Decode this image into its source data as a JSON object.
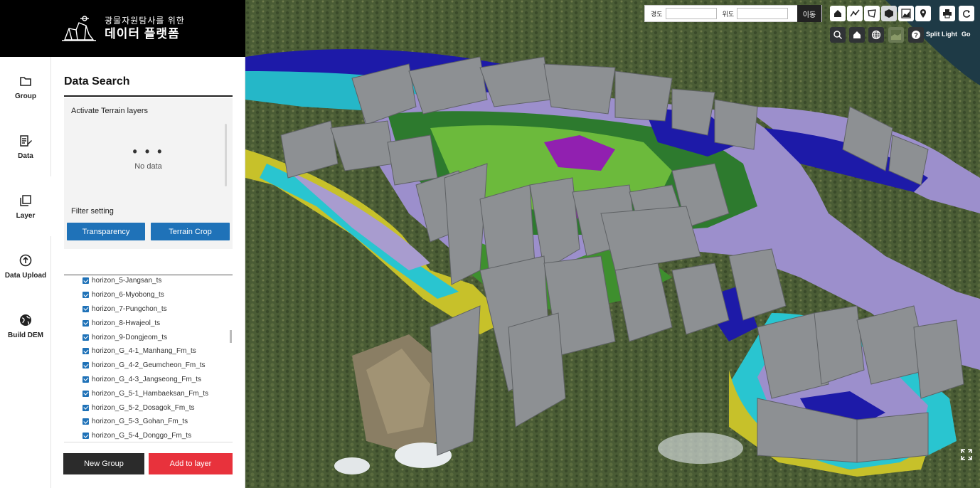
{
  "header": {
    "subtitle": "광물자원탐사를 위한",
    "title": "데이터 플랫폼"
  },
  "rail": [
    {
      "label": "Group",
      "icon": "folder-icon"
    },
    {
      "label": "Data",
      "icon": "data-edit-icon"
    },
    {
      "label": "Layer",
      "icon": "layers-icon"
    },
    {
      "label": "Data Upload",
      "icon": "upload-icon"
    },
    {
      "label": "Build DEM",
      "icon": "globe-icon"
    }
  ],
  "panel": {
    "title": "Data Search",
    "terrain_heading": "Activate Terrain layers",
    "dots": "• • •",
    "no_data": "No data",
    "filter_heading": "Filter setting",
    "transparency_label": "Transparency",
    "terrain_crop_label": "Terrain Crop",
    "layers": [
      "horizon_5-Jangsan_ts",
      "horizon_6-Myobong_ts",
      "horizon_7-Pungchon_ts",
      "horizon_8-Hwajeol_ts",
      "horizon_9-Dongjeom_ts",
      "horizon_G_4-1_Manhang_Fm_ts",
      "horizon_G_4-2_Geumcheon_Fm_ts",
      "horizon_G_4-3_Jangseong_Fm_ts",
      "horizon_G_5-1_Hambaeksan_Fm_ts",
      "horizon_G_5-2_Dosagok_Fm_ts",
      "horizon_G_5-3_Gohan_Fm_ts",
      "horizon_G_5-4_Donggo_Fm_ts"
    ],
    "new_group_label": "New Group",
    "add_layer_label": "Add to layer"
  },
  "map_toolbar": {
    "lon_label": "경도",
    "lat_label": "위도",
    "lon_value": "",
    "lat_value": "",
    "go_label": "이동",
    "split_label": "Split Light",
    "go2_label": "Go"
  },
  "colors": {
    "accent_blue": "#1f72b8",
    "accent_red": "#e8323c",
    "dark_button": "#2b2b2b"
  }
}
